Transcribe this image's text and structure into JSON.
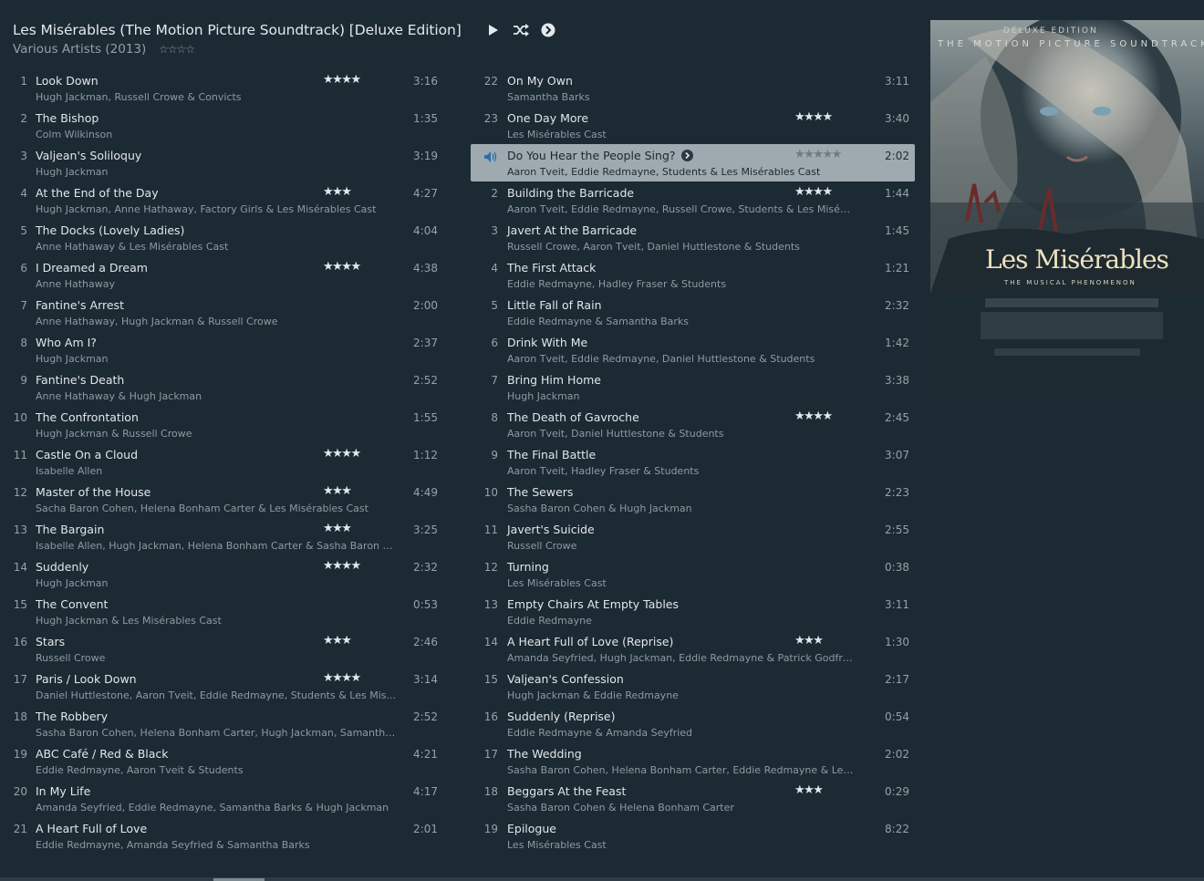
{
  "album": {
    "title": "Les Misérables (The Motion Picture Soundtrack) [Deluxe Edition]",
    "subtitle": "Various Artists (2013)",
    "rating_display": "☆☆☆☆"
  },
  "controls": [
    "play-icon",
    "shuffle-icon",
    "next-arrow-icon"
  ],
  "artwork": {
    "top_label": "DELUXE EDITION",
    "subtitle": "THE MOTION PICTURE SOUNDTRACK",
    "logo": "Les Misérables",
    "tagline": "THE MUSICAL PHENOMENON"
  },
  "left_tracks": [
    {
      "num": "1",
      "title": "Look Down",
      "artist": "Hugh Jackman, Russell Crowe & Convicts",
      "stars": "★★★★",
      "dur": "3:16"
    },
    {
      "num": "2",
      "title": "The Bishop",
      "artist": "Colm Wilkinson",
      "stars": "",
      "dur": "1:35"
    },
    {
      "num": "3",
      "title": "Valjean's Soliloquy",
      "artist": "Hugh Jackman",
      "stars": "",
      "dur": "3:19"
    },
    {
      "num": "4",
      "title": "At the End of the Day",
      "artist": "Hugh Jackman, Anne Hathaway, Factory Girls & Les Misérables Cast",
      "stars": "★★★",
      "dur": "4:27"
    },
    {
      "num": "5",
      "title": "The Docks (Lovely Ladies)",
      "artist": "Anne Hathaway & Les Misérables Cast",
      "stars": "",
      "dur": "4:04"
    },
    {
      "num": "6",
      "title": "I Dreamed a Dream",
      "artist": "Anne Hathaway",
      "stars": "★★★★",
      "dur": "4:38"
    },
    {
      "num": "7",
      "title": "Fantine's Arrest",
      "artist": "Anne Hathaway, Hugh Jackman & Russell Crowe",
      "stars": "",
      "dur": "2:00"
    },
    {
      "num": "8",
      "title": "Who Am I?",
      "artist": "Hugh Jackman",
      "stars": "",
      "dur": "2:37"
    },
    {
      "num": "9",
      "title": "Fantine's Death",
      "artist": "Anne Hathaway & Hugh Jackman",
      "stars": "",
      "dur": "2:52"
    },
    {
      "num": "10",
      "title": "The Confrontation",
      "artist": "Hugh Jackman & Russell Crowe",
      "stars": "",
      "dur": "1:55"
    },
    {
      "num": "11",
      "title": "Castle On a Cloud",
      "artist": "Isabelle Allen",
      "stars": "★★★★",
      "dur": "1:12"
    },
    {
      "num": "12",
      "title": "Master of the House",
      "artist": "Sacha Baron Cohen, Helena Bonham Carter & Les Misérables Cast",
      "stars": "★★★",
      "dur": "4:49"
    },
    {
      "num": "13",
      "title": "The Bargain",
      "artist": "Isabelle Allen, Hugh Jackman, Helena Bonham Carter & Sasha Baron C...",
      "stars": "★★★",
      "dur": "3:25"
    },
    {
      "num": "14",
      "title": "Suddenly",
      "artist": "Hugh Jackman",
      "stars": "★★★★",
      "dur": "2:32"
    },
    {
      "num": "15",
      "title": "The Convent",
      "artist": "Hugh Jackman & Les Misérables Cast",
      "stars": "",
      "dur": "0:53"
    },
    {
      "num": "16",
      "title": "Stars",
      "artist": "Russell Crowe",
      "stars": "★★★",
      "dur": "2:46"
    },
    {
      "num": "17",
      "title": "Paris / Look Down",
      "artist": "Daniel Huttlestone, Aaron Tveit, Eddie Redmayne, Students & Les Mis...",
      "stars": "★★★★",
      "dur": "3:14"
    },
    {
      "num": "18",
      "title": "The Robbery",
      "artist": "Sasha Baron Cohen, Helena Bonham Carter, Hugh Jackman, Samantha...",
      "stars": "",
      "dur": "2:52"
    },
    {
      "num": "19",
      "title": "ABC Café / Red & Black",
      "artist": "Eddie Redmayne, Aaron Tveit & Students",
      "stars": "",
      "dur": "4:21"
    },
    {
      "num": "20",
      "title": "In My Life",
      "artist": "Amanda Seyfried, Eddie Redmayne, Samantha Barks & Hugh Jackman",
      "stars": "",
      "dur": "4:17"
    },
    {
      "num": "21",
      "title": "A Heart Full of Love",
      "artist": "Eddie Redmayne, Amanda Seyfried & Samantha Barks",
      "stars": "",
      "dur": "2:01"
    }
  ],
  "right_tracks": [
    {
      "num": "22",
      "title": "On My Own",
      "artist": "Samantha Barks",
      "stars": "",
      "dur": "3:11"
    },
    {
      "num": "23",
      "title": "One Day More",
      "artist": "Les Misérables Cast",
      "stars": "★★★★",
      "dur": "3:40"
    },
    {
      "num": "",
      "title": "Do You Hear the People Sing?",
      "artist": "Aaron Tveit, Eddie Redmayne, Students & Les Misérables Cast",
      "stars": "★★★★★",
      "dur": "2:02",
      "playing": true
    },
    {
      "num": "2",
      "title": "Building the Barricade",
      "artist": "Aaron Tveit, Eddie Redmayne, Russell Crowe, Students & Les Misérabl...",
      "stars": "★★★★",
      "dur": "1:44"
    },
    {
      "num": "3",
      "title": "Javert At the Barricade",
      "artist": "Russell Crowe, Aaron Tveit, Daniel Huttlestone & Students",
      "stars": "",
      "dur": "1:45"
    },
    {
      "num": "4",
      "title": "The First Attack",
      "artist": "Eddie Redmayne, Hadley Fraser & Students",
      "stars": "",
      "dur": "1:21"
    },
    {
      "num": "5",
      "title": "Little Fall of Rain",
      "artist": "Eddie Redmayne & Samantha Barks",
      "stars": "",
      "dur": "2:32"
    },
    {
      "num": "6",
      "title": "Drink With Me",
      "artist": "Aaron Tveit, Eddie Redmayne, Daniel Huttlestone & Students",
      "stars": "",
      "dur": "1:42"
    },
    {
      "num": "7",
      "title": "Bring Him Home",
      "artist": "Hugh Jackman",
      "stars": "",
      "dur": "3:38"
    },
    {
      "num": "8",
      "title": "The Death of Gavroche",
      "artist": "Aaron Tveit, Daniel Huttlestone & Students",
      "stars": "★★★★",
      "dur": "2:45"
    },
    {
      "num": "9",
      "title": "The Final Battle",
      "artist": "Aaron Tveit, Hadley Fraser & Students",
      "stars": "",
      "dur": "3:07"
    },
    {
      "num": "10",
      "title": "The Sewers",
      "artist": "Sasha Baron Cohen & Hugh Jackman",
      "stars": "",
      "dur": "2:23"
    },
    {
      "num": "11",
      "title": "Javert's Suicide",
      "artist": "Russell Crowe",
      "stars": "",
      "dur": "2:55"
    },
    {
      "num": "12",
      "title": "Turning",
      "artist": "Les Misérables Cast",
      "stars": "",
      "dur": "0:38"
    },
    {
      "num": "13",
      "title": "Empty Chairs At Empty Tables",
      "artist": "Eddie Redmayne",
      "stars": "",
      "dur": "3:11"
    },
    {
      "num": "14",
      "title": "A Heart Full of Love (Reprise)",
      "artist": "Amanda Seyfried, Hugh Jackman, Eddie Redmayne & Patrick Godfrey",
      "stars": "★★★",
      "dur": "1:30"
    },
    {
      "num": "15",
      "title": "Valjean's Confession",
      "artist": "Hugh Jackman & Eddie Redmayne",
      "stars": "",
      "dur": "2:17"
    },
    {
      "num": "16",
      "title": "Suddenly (Reprise)",
      "artist": "Eddie Redmayne & Amanda Seyfried",
      "stars": "",
      "dur": "0:54"
    },
    {
      "num": "17",
      "title": "The Wedding",
      "artist": "Sasha Baron Cohen, Helena Bonham Carter, Eddie Redmayne & Les M...",
      "stars": "",
      "dur": "2:02"
    },
    {
      "num": "18",
      "title": "Beggars At the Feast",
      "artist": "Sasha Baron Cohen & Helena Bonham Carter",
      "stars": "★★★",
      "dur": "0:29"
    },
    {
      "num": "19",
      "title": "Epilogue",
      "artist": "Les Misérables Cast",
      "stars": "",
      "dur": "8:22"
    }
  ],
  "colors": {
    "background": "#1b2a33",
    "playing_row": "#9eaab0",
    "text_primary": "#e2e7ea",
    "text_secondary": "#8e9ba1"
  }
}
